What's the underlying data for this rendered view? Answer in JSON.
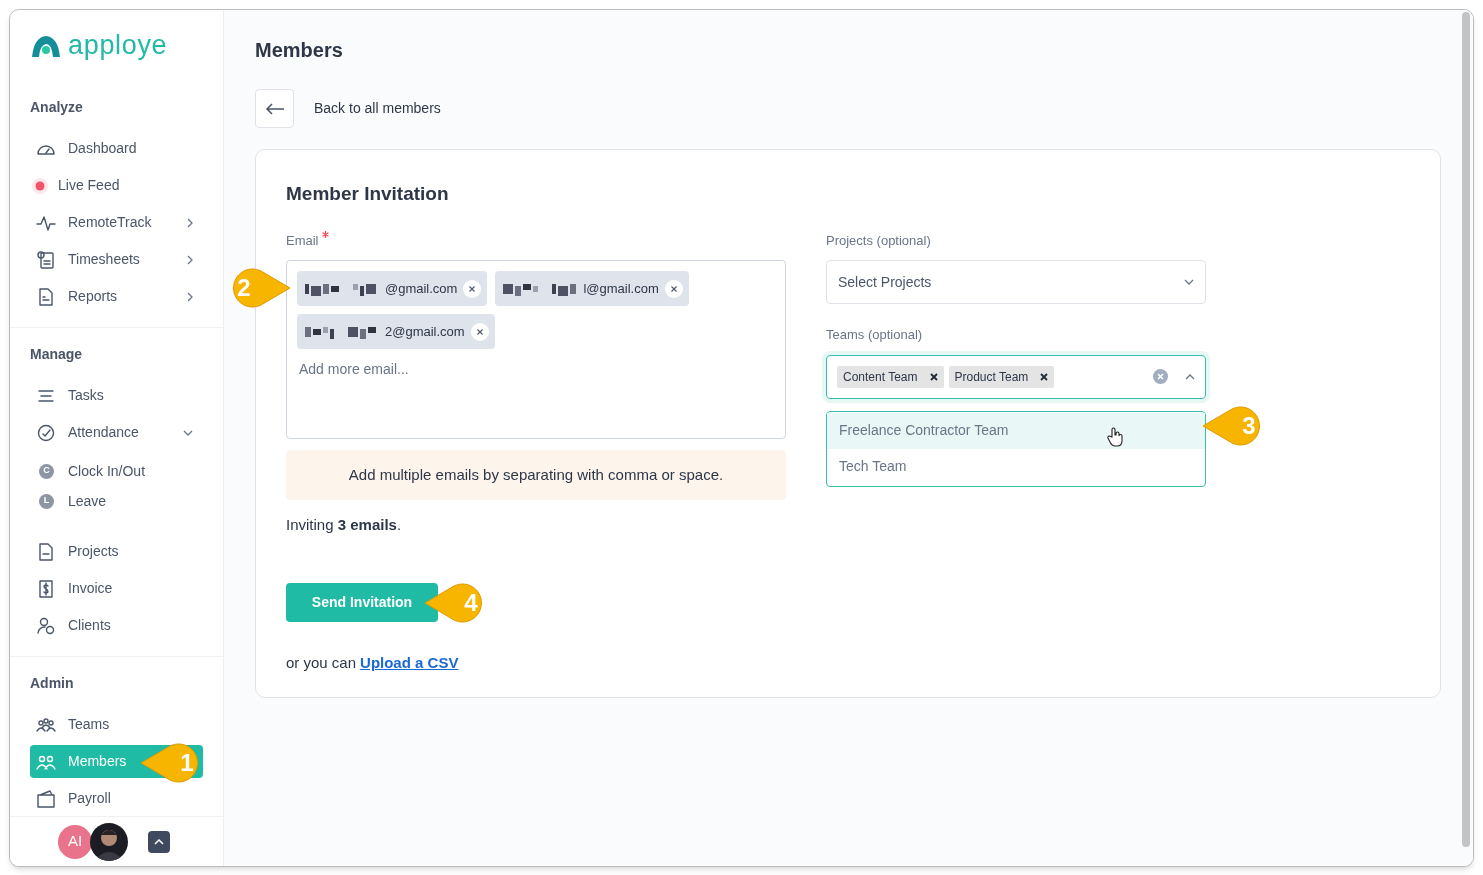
{
  "logo": {
    "text": "apploye"
  },
  "sidebar": {
    "sections": [
      {
        "heading": "Analyze",
        "items": [
          {
            "label": "Dashboard",
            "selected": false
          },
          {
            "label": "Live Feed",
            "selected": false
          },
          {
            "label": "RemoteTrack",
            "selected": false,
            "expanded": false
          },
          {
            "label": "Timesheets",
            "selected": false,
            "expanded": false
          },
          {
            "label": "Reports",
            "selected": false,
            "expanded": false
          }
        ]
      },
      {
        "heading": "Manage",
        "items": [
          {
            "label": "Tasks",
            "selected": false
          },
          {
            "label": "Attendance",
            "selected": false,
            "expanded": true,
            "children": [
              {
                "label": "Clock In/Out",
                "badge": "C"
              },
              {
                "label": "Leave",
                "badge": "L"
              }
            ]
          },
          {
            "label": "Projects",
            "selected": false
          },
          {
            "label": "Invoice",
            "selected": false
          },
          {
            "label": "Clients",
            "selected": false
          }
        ]
      },
      {
        "heading": "Admin",
        "items": [
          {
            "label": "Teams",
            "selected": false
          },
          {
            "label": "Members",
            "selected": true
          },
          {
            "label": "Payroll",
            "selected": false
          }
        ]
      }
    ]
  },
  "footer": {
    "initials": "AI"
  },
  "page_title": "Members",
  "back_link": "Back to all members",
  "form": {
    "title": "Member Invitation",
    "email": {
      "label": "Email",
      "required": true,
      "chips": [
        {
          "text": "@gmail.com"
        },
        {
          "text": "l@gmail.com"
        },
        {
          "text": "2@gmail.com"
        }
      ],
      "placeholder": "Add more email..."
    },
    "hint": "Add multiple emails by separating with comma or space.",
    "summary": "Inviting **3 emails**.",
    "projects": {
      "label": "Projects (optional)",
      "placeholder": "Select Projects",
      "expanded": false
    },
    "teams": {
      "label": "Teams (optional)",
      "expanded": true,
      "chips": [
        {
          "text": "Content Team"
        },
        {
          "text": "Product Team"
        }
      ],
      "options": [
        {
          "label": "Freelance Contractor Team",
          "highlighted": true
        },
        {
          "label": "Tech Team",
          "highlighted": false
        }
      ]
    },
    "submit": "Send Invitation",
    "csv": {
      "text": "or you can",
      "link": "Upload a CSV"
    }
  },
  "callouts": [
    {
      "number": "1"
    },
    {
      "number": "2"
    },
    {
      "number": "3"
    },
    {
      "number": "4"
    }
  ]
}
